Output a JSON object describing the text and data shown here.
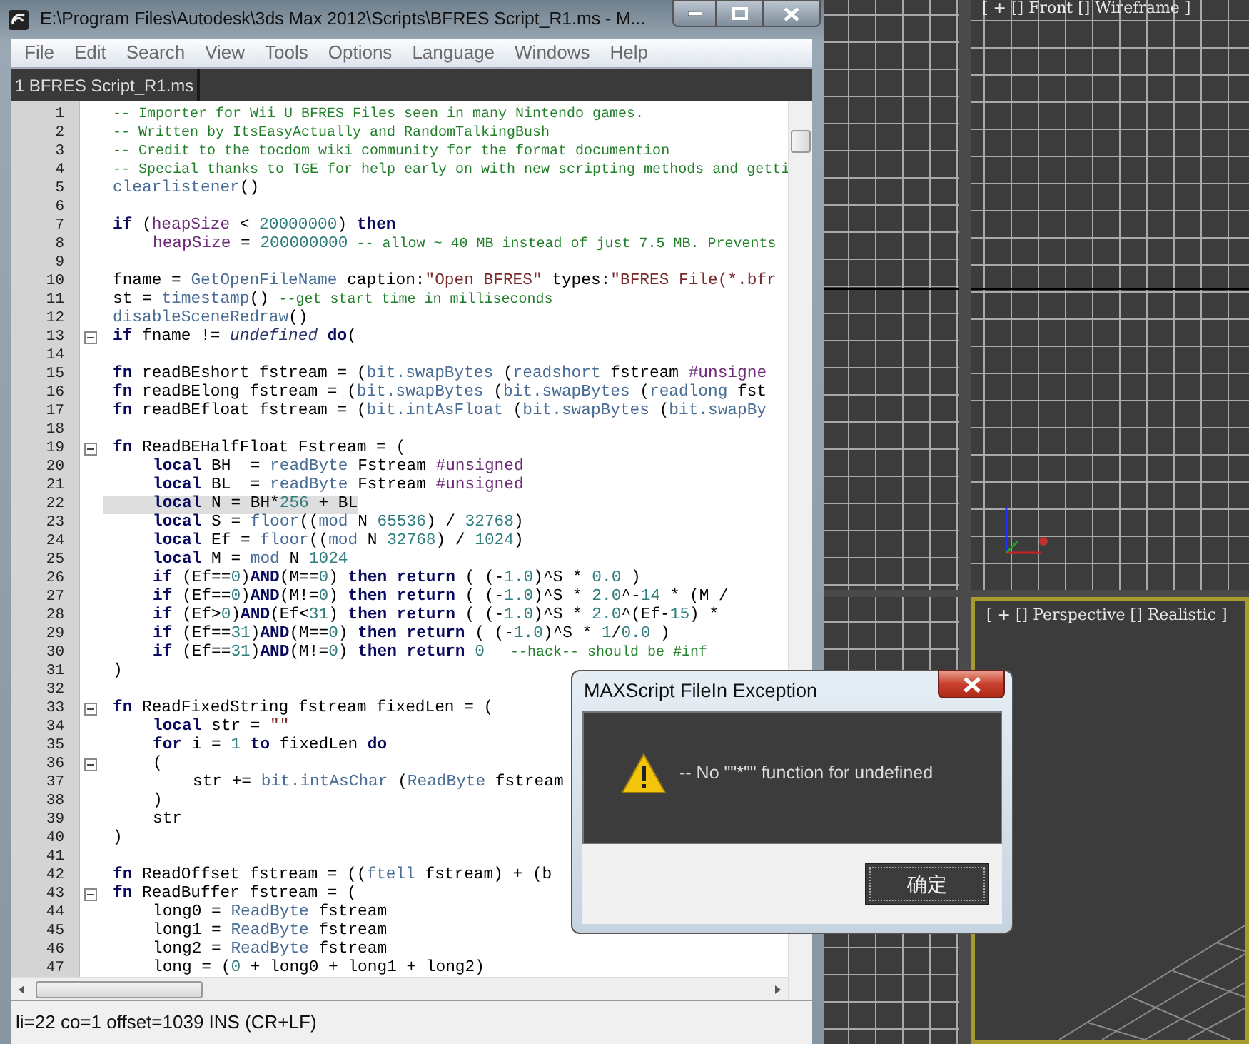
{
  "editor": {
    "title": "E:\\Program Files\\Autodesk\\3ds Max 2012\\Scripts\\BFRES Script_R1.ms - M...",
    "menu": [
      "File",
      "Edit",
      "Search",
      "View",
      "Tools",
      "Options",
      "Language",
      "Windows",
      "Help"
    ],
    "tabs": [
      {
        "label": "1 BFRES Script_R1.ms",
        "selected": true
      }
    ],
    "code_lines": [
      {
        "number": "1",
        "fold": false,
        "highlighted": false,
        "tokens": [
          {
            "kind": "comment",
            "text": "-- Importer for Wii U BFRES Files seen in many Nintendo games."
          }
        ]
      },
      {
        "number": "2",
        "fold": false,
        "highlighted": false,
        "tokens": [
          {
            "kind": "comment",
            "text": "-- Written by ItsEasyActually and RandomTalkingBush"
          }
        ]
      },
      {
        "number": "3",
        "fold": false,
        "highlighted": false,
        "tokens": [
          {
            "kind": "comment",
            "text": "-- Credit to the tocdom wiki community for the format documention"
          }
        ]
      },
      {
        "number": "4",
        "fold": false,
        "highlighted": false,
        "tokens": [
          {
            "kind": "comment",
            "text": "-- Special thanks to TGE for help early on with new scripting methods and getti"
          }
        ]
      },
      {
        "number": "5",
        "fold": false,
        "highlighted": false,
        "tokens": [
          {
            "kind": "function",
            "text": "clearlistener"
          },
          {
            "kind": "plain",
            "text": "()"
          }
        ]
      },
      {
        "number": "6",
        "fold": false,
        "highlighted": false
      },
      {
        "number": "7",
        "fold": false,
        "highlighted": false,
        "tokens": [
          {
            "kind": "keyword",
            "text": "if"
          },
          {
            "kind": "plain",
            "text": " ("
          },
          {
            "kind": "variable",
            "text": "heapSize"
          },
          {
            "kind": "plain",
            "text": " < "
          },
          {
            "kind": "number",
            "text": "20000000"
          },
          {
            "kind": "plain",
            "text": ") "
          },
          {
            "kind": "keyword",
            "text": "then"
          }
        ],
        "children": [
          {
            "number": "8",
            "fold": false,
            "highlighted": false,
            "tokens": [
              {
                "kind": "variable",
                "text": "heapSize"
              },
              {
                "kind": "plain",
                "text": " = "
              },
              {
                "kind": "number",
                "text": "200000000"
              },
              {
                "kind": "comment",
                "text": " -- allow ~ 40 MB instead of just 7.5 MB. Prevents"
              }
            ]
          }
        ]
      },
      {
        "number": "9",
        "fold": false,
        "highlighted": false
      },
      {
        "number": "10",
        "fold": false,
        "highlighted": false,
        "tokens": [
          {
            "kind": "plain",
            "text": "fname = "
          },
          {
            "kind": "function",
            "text": "GetOpenFileName"
          },
          {
            "kind": "plain",
            "text": " caption:"
          },
          {
            "kind": "string",
            "text": "\"Open BFRES\""
          },
          {
            "kind": "plain",
            "text": " types:"
          },
          {
            "kind": "string",
            "text": "\"BFRES File(*.bfr"
          }
        ]
      },
      {
        "number": "11",
        "fold": false,
        "highlighted": false,
        "tokens": [
          {
            "kind": "plain",
            "text": "st = "
          },
          {
            "kind": "function",
            "text": "timestamp"
          },
          {
            "kind": "plain",
            "text": "() "
          },
          {
            "kind": "comment",
            "text": "--get start time in milliseconds"
          }
        ]
      },
      {
        "number": "12",
        "fold": false,
        "highlighted": false,
        "tokens": [
          {
            "kind": "function",
            "text": "disableSceneRedraw"
          },
          {
            "kind": "plain",
            "text": "()"
          }
        ]
      },
      {
        "number": "13",
        "fold": true,
        "highlighted": false,
        "tokens": [
          {
            "kind": "keyword",
            "text": "if"
          },
          {
            "kind": "plain",
            "text": " fname != "
          },
          {
            "kind": "constant",
            "text": "undefined"
          },
          {
            "kind": "keyword",
            "text": " do"
          },
          {
            "kind": "plain",
            "text": "("
          }
        ]
      },
      {
        "number": "14",
        "fold": false,
        "highlighted": false
      },
      {
        "number": "15",
        "fold": false,
        "highlighted": false,
        "tokens": [
          {
            "kind": "keyword",
            "text": "fn"
          },
          {
            "kind": "plain",
            "text": " readBEshort fstream = ("
          },
          {
            "kind": "function",
            "text": "bit.swapBytes"
          },
          {
            "kind": "plain",
            "text": " ("
          },
          {
            "kind": "function",
            "text": "readshort"
          },
          {
            "kind": "plain",
            "text": " fstream "
          },
          {
            "kind": "variable",
            "text": "#unsigne"
          }
        ]
      },
      {
        "number": "16",
        "fold": false,
        "highlighted": false,
        "tokens": [
          {
            "kind": "keyword",
            "text": "fn"
          },
          {
            "kind": "plain",
            "text": " readBElong fstream = ("
          },
          {
            "kind": "function",
            "text": "bit.swapBytes"
          },
          {
            "kind": "plain",
            "text": " ("
          },
          {
            "kind": "function",
            "text": "bit.swapBytes"
          },
          {
            "kind": "plain",
            "text": " ("
          },
          {
            "kind": "function",
            "text": "readlong"
          },
          {
            "kind": "plain",
            "text": " fst"
          }
        ]
      },
      {
        "number": "17",
        "fold": false,
        "highlighted": false,
        "tokens": [
          {
            "kind": "keyword",
            "text": "fn"
          },
          {
            "kind": "plain",
            "text": " readBEfloat fstream = ("
          },
          {
            "kind": "function",
            "text": "bit.intAsFloat"
          },
          {
            "kind": "plain",
            "text": " ("
          },
          {
            "kind": "function",
            "text": "bit.swapBytes"
          },
          {
            "kind": "plain",
            "text": " ("
          },
          {
            "kind": "function",
            "text": "bit.swapBy"
          }
        ]
      },
      {
        "number": "18",
        "fold": false,
        "highlighted": false
      },
      {
        "number": "19",
        "fold": true,
        "highlighted": false,
        "tokens": [
          {
            "kind": "keyword",
            "text": "fn"
          },
          {
            "kind": "plain",
            "text": " ReadBEHalfFloat Fstream = ("
          }
        ],
        "children": [
          {
            "number": "20",
            "fold": false,
            "highlighted": false,
            "tokens": [
              {
                "kind": "keyword",
                "text": "local"
              },
              {
                "kind": "plain",
                "text": " BH  = "
              },
              {
                "kind": "function",
                "text": "readByte"
              },
              {
                "kind": "plain",
                "text": " Fstream "
              },
              {
                "kind": "variable",
                "text": "#unsigned"
              }
            ]
          },
          {
            "number": "21",
            "fold": false,
            "highlighted": false,
            "tokens": [
              {
                "kind": "keyword",
                "text": "local"
              },
              {
                "kind": "plain",
                "text": " BL  = "
              },
              {
                "kind": "function",
                "text": "readByte"
              },
              {
                "kind": "plain",
                "text": " Fstream "
              },
              {
                "kind": "variable",
                "text": "#unsigned"
              }
            ]
          },
          {
            "number": "22",
            "fold": false,
            "highlighted": true,
            "tokens": [
              {
                "kind": "keyword",
                "text": "local"
              },
              {
                "kind": "plain",
                "text": " N = BH*"
              },
              {
                "kind": "number",
                "text": "256"
              },
              {
                "kind": "plain",
                "text": " + BL"
              }
            ]
          },
          {
            "number": "23",
            "fold": false,
            "highlighted": false,
            "tokens": [
              {
                "kind": "keyword",
                "text": "local"
              },
              {
                "kind": "plain",
                "text": " S = "
              },
              {
                "kind": "function",
                "text": "floor"
              },
              {
                "kind": "plain",
                "text": "(("
              },
              {
                "kind": "function",
                "text": "mod"
              },
              {
                "kind": "plain",
                "text": " N "
              },
              {
                "kind": "number",
                "text": "65536"
              },
              {
                "kind": "plain",
                "text": ") / "
              },
              {
                "kind": "number",
                "text": "32768"
              },
              {
                "kind": "plain",
                "text": ")"
              }
            ]
          },
          {
            "number": "24",
            "fold": false,
            "highlighted": false,
            "tokens": [
              {
                "kind": "keyword",
                "text": "local"
              },
              {
                "kind": "plain",
                "text": " Ef = "
              },
              {
                "kind": "function",
                "text": "floor"
              },
              {
                "kind": "plain",
                "text": "(("
              },
              {
                "kind": "function",
                "text": "mod"
              },
              {
                "kind": "plain",
                "text": " N "
              },
              {
                "kind": "number",
                "text": "32768"
              },
              {
                "kind": "plain",
                "text": ") / "
              },
              {
                "kind": "number",
                "text": "1024"
              },
              {
                "kind": "plain",
                "text": ")"
              }
            ]
          },
          {
            "number": "25",
            "fold": false,
            "highlighted": false,
            "tokens": [
              {
                "kind": "keyword",
                "text": "local"
              },
              {
                "kind": "plain",
                "text": " M = "
              },
              {
                "kind": "function",
                "text": "mod"
              },
              {
                "kind": "plain",
                "text": " N "
              },
              {
                "kind": "number",
                "text": "1024"
              }
            ]
          },
          {
            "number": "26",
            "fold": false,
            "highlighted": false,
            "tokens": [
              {
                "kind": "keyword",
                "text": "if"
              },
              {
                "kind": "plain",
                "text": " (Ef=="
              },
              {
                "kind": "number",
                "text": "0"
              },
              {
                "kind": "plain",
                "text": ")"
              },
              {
                "kind": "keyword",
                "text": "AND"
              },
              {
                "kind": "plain",
                "text": "(M=="
              },
              {
                "kind": "number",
                "text": "0"
              },
              {
                "kind": "plain",
                "text": ") "
              },
              {
                "kind": "keyword",
                "text": "then return"
              },
              {
                "kind": "plain",
                "text": " ( (-"
              },
              {
                "kind": "number",
                "text": "1.0"
              },
              {
                "kind": "plain",
                "text": ")^S * "
              },
              {
                "kind": "number",
                "text": "0.0"
              },
              {
                "kind": "plain",
                "text": " )"
              }
            ]
          },
          {
            "number": "27",
            "fold": false,
            "highlighted": false,
            "tokens": [
              {
                "kind": "keyword",
                "text": "if"
              },
              {
                "kind": "plain",
                "text": " (Ef=="
              },
              {
                "kind": "number",
                "text": "0"
              },
              {
                "kind": "plain",
                "text": ")"
              },
              {
                "kind": "keyword",
                "text": "AND"
              },
              {
                "kind": "plain",
                "text": "(M!="
              },
              {
                "kind": "number",
                "text": "0"
              },
              {
                "kind": "plain",
                "text": ") "
              },
              {
                "kind": "keyword",
                "text": "then return"
              },
              {
                "kind": "plain",
                "text": " ( (-"
              },
              {
                "kind": "number",
                "text": "1.0"
              },
              {
                "kind": "plain",
                "text": ")^S * "
              },
              {
                "kind": "number",
                "text": "2.0"
              },
              {
                "kind": "plain",
                "text": "^-"
              },
              {
                "kind": "number",
                "text": "14"
              },
              {
                "kind": "plain",
                "text": " * (M /"
              }
            ]
          },
          {
            "number": "28",
            "fold": false,
            "highlighted": false,
            "tokens": [
              {
                "kind": "keyword",
                "text": "if"
              },
              {
                "kind": "plain",
                "text": " (Ef>"
              },
              {
                "kind": "number",
                "text": "0"
              },
              {
                "kind": "plain",
                "text": ")"
              },
              {
                "kind": "keyword",
                "text": "AND"
              },
              {
                "kind": "plain",
                "text": "(Ef<"
              },
              {
                "kind": "number",
                "text": "31"
              },
              {
                "kind": "plain",
                "text": ") "
              },
              {
                "kind": "keyword",
                "text": "then return"
              },
              {
                "kind": "plain",
                "text": " ( (-"
              },
              {
                "kind": "number",
                "text": "1.0"
              },
              {
                "kind": "plain",
                "text": ")^S * "
              },
              {
                "kind": "number",
                "text": "2.0"
              },
              {
                "kind": "plain",
                "text": "^(Ef-"
              },
              {
                "kind": "number",
                "text": "15"
              },
              {
                "kind": "plain",
                "text": ") *"
              }
            ]
          },
          {
            "number": "29",
            "fold": false,
            "highlighted": false,
            "tokens": [
              {
                "kind": "keyword",
                "text": "if"
              },
              {
                "kind": "plain",
                "text": " (Ef=="
              },
              {
                "kind": "number",
                "text": "31"
              },
              {
                "kind": "plain",
                "text": ")"
              },
              {
                "kind": "keyword",
                "text": "AND"
              },
              {
                "kind": "plain",
                "text": "(M=="
              },
              {
                "kind": "number",
                "text": "0"
              },
              {
                "kind": "plain",
                "text": ") "
              },
              {
                "kind": "keyword",
                "text": "then return"
              },
              {
                "kind": "plain",
                "text": " ( (-"
              },
              {
                "kind": "number",
                "text": "1.0"
              },
              {
                "kind": "plain",
                "text": ")^S * "
              },
              {
                "kind": "number",
                "text": "1"
              },
              {
                "kind": "plain",
                "text": "/"
              },
              {
                "kind": "number",
                "text": "0.0"
              },
              {
                "kind": "plain",
                "text": " )"
              }
            ]
          },
          {
            "number": "30",
            "fold": false,
            "highlighted": false,
            "tokens": [
              {
                "kind": "keyword",
                "text": "if"
              },
              {
                "kind": "plain",
                "text": " (Ef=="
              },
              {
                "kind": "number",
                "text": "31"
              },
              {
                "kind": "plain",
                "text": ")"
              },
              {
                "kind": "keyword",
                "text": "AND"
              },
              {
                "kind": "plain",
                "text": "(M!="
              },
              {
                "kind": "number",
                "text": "0"
              },
              {
                "kind": "plain",
                "text": ") "
              },
              {
                "kind": "keyword",
                "text": "then return"
              },
              {
                "kind": "number",
                "text": " 0"
              },
              {
                "kind": "comment",
                "text": "   --hack-- should be #inf"
              }
            ]
          }
        ]
      },
      {
        "number": "31",
        "fold": false,
        "highlighted": false,
        "tokens": [
          {
            "kind": "plain",
            "text": ")"
          }
        ]
      },
      {
        "number": "32",
        "fold": false,
        "highlighted": false
      },
      {
        "number": "33",
        "fold": true,
        "highlighted": false,
        "tokens": [
          {
            "kind": "keyword",
            "text": "fn"
          },
          {
            "kind": "plain",
            "text": " ReadFixedString fstream fixedLen = ("
          }
        ],
        "children": [
          {
            "number": "34",
            "fold": false,
            "highlighted": false,
            "tokens": [
              {
                "kind": "keyword",
                "text": "local"
              },
              {
                "kind": "plain",
                "text": " str = "
              },
              {
                "kind": "string",
                "text": "\"\""
              }
            ]
          },
          {
            "number": "35",
            "fold": false,
            "highlighted": false,
            "tokens": [
              {
                "kind": "keyword",
                "text": "for"
              },
              {
                "kind": "plain",
                "text": " i = "
              },
              {
                "kind": "number",
                "text": "1"
              },
              {
                "kind": "keyword",
                "text": " to"
              },
              {
                "kind": "plain",
                "text": " fixedLen "
              },
              {
                "kind": "keyword",
                "text": "do"
              }
            ]
          },
          {
            "number": "36",
            "fold": true,
            "highlighted": false,
            "tokens": [
              {
                "kind": "plain",
                "text": "("
              }
            ],
            "children": [
              {
                "number": "37",
                "fold": false,
                "highlighted": false,
                "tokens": [
                  {
                    "kind": "plain",
                    "text": "str += "
                  },
                  {
                    "kind": "function",
                    "text": "bit.intAsChar"
                  },
                  {
                    "kind": "plain",
                    "text": " ("
                  },
                  {
                    "kind": "function",
                    "text": "ReadByte"
                  },
                  {
                    "kind": "plain",
                    "text": " fstream"
                  }
                ]
              }
            ]
          },
          {
            "number": "38",
            "fold": false,
            "highlighted": false,
            "tokens": [
              {
                "kind": "plain",
                "text": ")"
              }
            ]
          },
          {
            "number": "39",
            "fold": false,
            "highlighted": false,
            "tokens": [
              {
                "kind": "plain",
                "text": "str"
              }
            ]
          }
        ]
      },
      {
        "number": "40",
        "fold": false,
        "highlighted": false,
        "tokens": [
          {
            "kind": "plain",
            "text": ")"
          }
        ]
      },
      {
        "number": "41",
        "fold": false,
        "highlighted": false
      },
      {
        "number": "42",
        "fold": false,
        "highlighted": false,
        "tokens": [
          {
            "kind": "keyword",
            "text": "fn"
          },
          {
            "kind": "plain",
            "text": " ReadOffset fstream = (("
          },
          {
            "kind": "function",
            "text": "ftell"
          },
          {
            "kind": "plain",
            "text": " fstream) + (b"
          }
        ]
      },
      {
        "number": "43",
        "fold": true,
        "highlighted": false,
        "tokens": [
          {
            "kind": "keyword",
            "text": "fn"
          },
          {
            "kind": "plain",
            "text": " ReadBuffer fstream = ("
          }
        ],
        "children": [
          {
            "number": "44",
            "fold": false,
            "highlighted": false,
            "tokens": [
              {
                "kind": "plain",
                "text": "long0 = "
              },
              {
                "kind": "function",
                "text": "ReadByte"
              },
              {
                "kind": "plain",
                "text": " fstream"
              }
            ]
          },
          {
            "number": "45",
            "fold": false,
            "highlighted": false,
            "tokens": [
              {
                "kind": "plain",
                "text": "long1 = "
              },
              {
                "kind": "function",
                "text": "ReadByte"
              },
              {
                "kind": "plain",
                "text": " fstream"
              }
            ]
          },
          {
            "number": "46",
            "fold": false,
            "highlighted": false,
            "tokens": [
              {
                "kind": "plain",
                "text": "long2 = "
              },
              {
                "kind": "function",
                "text": "ReadByte"
              },
              {
                "kind": "plain",
                "text": " fstream"
              }
            ]
          },
          {
            "number": "47",
            "fold": false,
            "highlighted": false,
            "tokens": [
              {
                "kind": "plain",
                "text": "long = ("
              },
              {
                "kind": "number",
                "text": "0"
              },
              {
                "kind": "plain",
                "text": " + long0 + long1 + long2)"
              }
            ]
          }
        ]
      }
    ],
    "status_bar": "li=22 co=1 offset=1039 INS (CR+LF)"
  },
  "viewports": [
    {
      "label": "[ + [] Front [] Wireframe ]",
      "selected": false
    },
    {
      "label": "[ + [] Perspective [] Realistic ]",
      "selected": true
    }
  ],
  "dialog": {
    "title": "MAXScript FileIn Exception",
    "message": "-- No \"\"*\"\" function for undefined",
    "buttons": [
      "确定"
    ]
  }
}
